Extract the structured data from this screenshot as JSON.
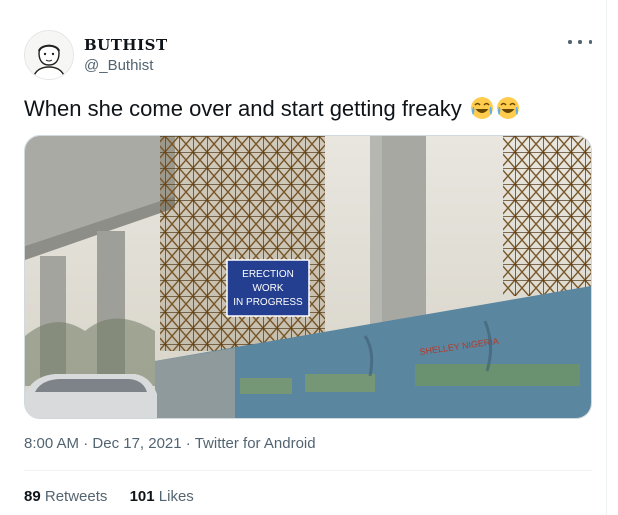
{
  "tweet": {
    "author_name": "BUTHIST",
    "author_handle": "@_Buthist",
    "text": "When she come over and start getting freaky",
    "emoji_icon": "face-with-tears-of-joy",
    "emoji_count": 2,
    "media": {
      "sign_lines": [
        "ERECTION",
        "WORK",
        "IN PROGRESS"
      ],
      "wall_text": "SHELLEY NIGERIA"
    },
    "time": "8:00 AM",
    "date": "Dec 17, 2021",
    "separator": "·",
    "source": "Twitter for Android",
    "retweets_count": "89",
    "retweets_label": "Retweets",
    "likes_count": "101",
    "likes_label": "Likes"
  },
  "colors": {
    "text_primary": "#0f1419",
    "text_secondary": "#536471",
    "divider": "#eff3f4",
    "sign_blue": "#243f8f",
    "wall_blue": "#5b86a0"
  }
}
